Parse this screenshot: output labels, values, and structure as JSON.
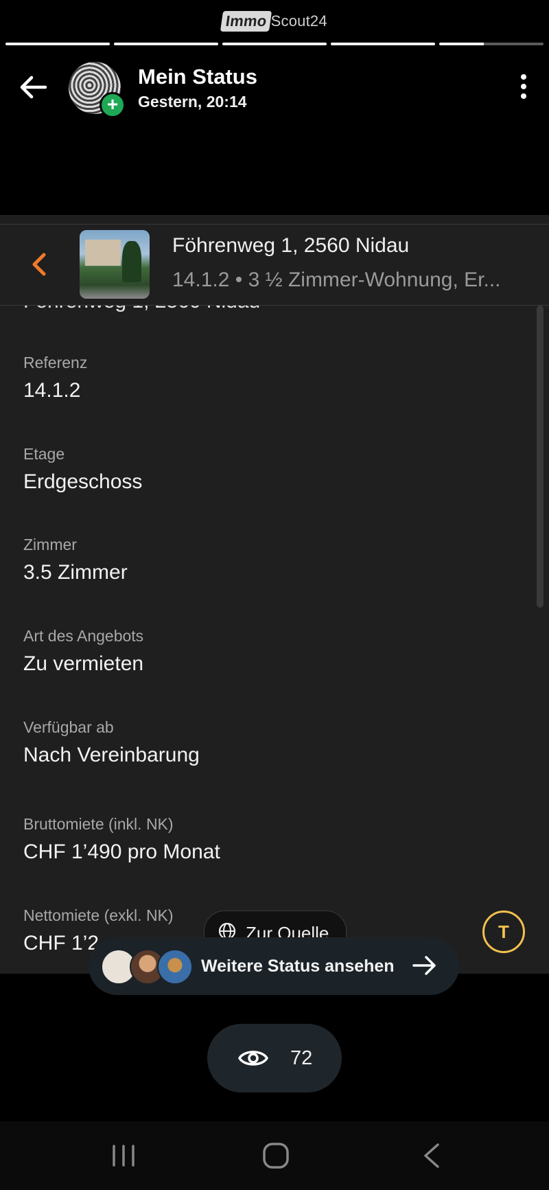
{
  "brand": {
    "part1": "Immo",
    "part2": "Scout24"
  },
  "progress": [
    1,
    1,
    1,
    1,
    0.43
  ],
  "header": {
    "title": "Mein Status",
    "subtitle": "Gestern, 20:14"
  },
  "listing": {
    "address": "Föhrenweg 1, 2560 Nidau",
    "summary": "14.1.2 • 3 ½ Zimmer-Wohnung, Er...",
    "cut_text": "Föhrenweg 1, 2560 Nidau"
  },
  "fields": [
    {
      "label": "Referenz",
      "value": "14.1.2"
    },
    {
      "label": "Etage",
      "value": "Erdgeschoss"
    },
    {
      "label": "Zimmer",
      "value": "3.5 Zimmer"
    },
    {
      "label": "Art des Angebots",
      "value": "Zu vermieten"
    },
    {
      "label": "Verfügbar ab",
      "value": "Nach Vereinbarung"
    },
    {
      "label": "Bruttomiete (inkl. NK)",
      "value": "CHF 1’490 pro Monat"
    },
    {
      "label": "Nettomiete (exkl. NK)",
      "value": "CHF 1’2"
    }
  ],
  "source_button": "Zur Quelle",
  "text_button": "T",
  "more_status": "Weitere Status ansehen",
  "views": "72",
  "colors": {
    "accent": "#f07a2b",
    "badge": "#1fa855",
    "text_tool": "#f2c14e"
  }
}
